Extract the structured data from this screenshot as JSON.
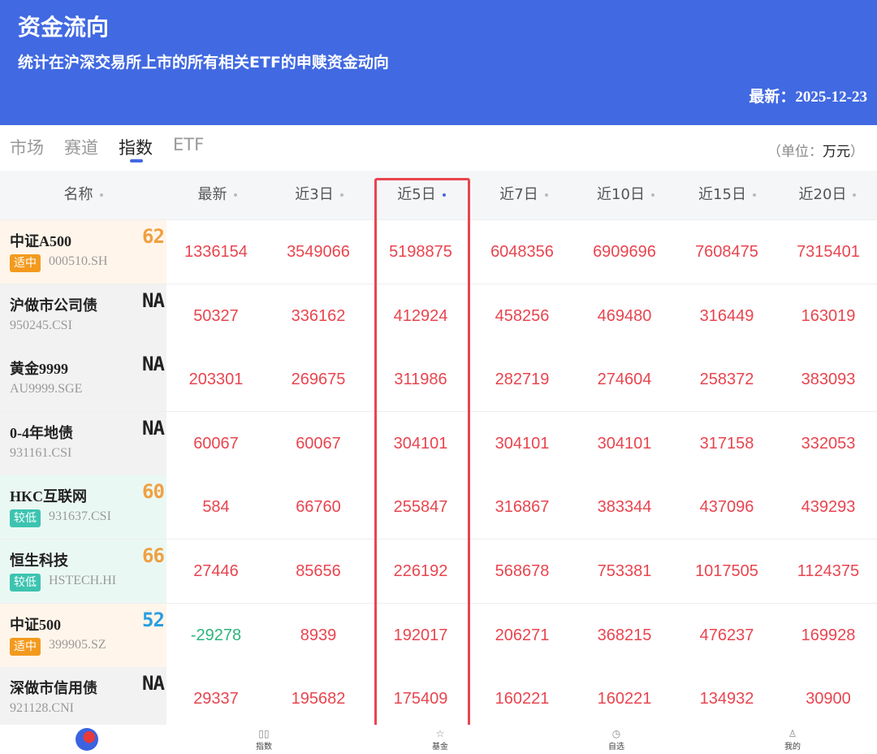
{
  "header": {
    "title": "资金流向",
    "subtitle": "统计在沪深交易所上市的所有相关ETF的申赎资金动向",
    "date_label": "最新：",
    "date": "2025-12-23"
  },
  "tabs": [
    {
      "label": "市场",
      "active": false
    },
    {
      "label": "赛道",
      "active": false
    },
    {
      "label": "指数",
      "active": true
    },
    {
      "label": "ETF",
      "active": false
    }
  ],
  "unit": {
    "prefix": "（单位：",
    "value": "万元",
    "suffix": "）"
  },
  "columns": [
    "名称",
    "最新",
    "近3日",
    "近5日",
    "近7日",
    "近10日",
    "近15日",
    "近20日"
  ],
  "sorted_column": "近5日",
  "colors": {
    "brand": "#4169e1",
    "positive": "#e8454f",
    "negative": "#2db47c",
    "tag_moderate": "#f39a1e",
    "tag_low": "#3cc4b0",
    "highlight_box": "#e8454f"
  },
  "rows": [
    {
      "name": "中证A500",
      "tag": "适中",
      "code": "000510.SH",
      "score": "62",
      "score_color": "#f0a040",
      "bg": "#fff5ea",
      "values": [
        "1336154",
        "3549066",
        "5198875",
        "6048356",
        "6909696",
        "7608475",
        "7315401"
      ]
    },
    {
      "name": "沪做市公司债",
      "tag": "",
      "code": "950245.CSI",
      "score": "NA",
      "score_color": "#222222",
      "bg": "#f2f2f2",
      "values": [
        "50327",
        "336162",
        "412924",
        "458256",
        "469480",
        "316449",
        "163019"
      ]
    },
    {
      "name": "黄金9999",
      "tag": "",
      "code": "AU9999.SGE",
      "score": "NA",
      "score_color": "#222222",
      "bg": "#f2f2f2",
      "values": [
        "203301",
        "269675",
        "311986",
        "282719",
        "274604",
        "258372",
        "383093"
      ]
    },
    {
      "name": "0-4年地债",
      "tag": "",
      "code": "931161.CSI",
      "score": "NA",
      "score_color": "#222222",
      "bg": "#f2f2f2",
      "values": [
        "60067",
        "60067",
        "304101",
        "304101",
        "304101",
        "317158",
        "332053"
      ]
    },
    {
      "name": "HKC互联网",
      "tag": "较低",
      "code": "931637.CSI",
      "score": "60",
      "score_color": "#f0a040",
      "bg": "#eaf8f4",
      "values": [
        "584",
        "66760",
        "255847",
        "316867",
        "383344",
        "437096",
        "439293"
      ]
    },
    {
      "name": "恒生科技",
      "tag": "较低",
      "code": "HSTECH.HI",
      "score": "66",
      "score_color": "#f0a040",
      "bg": "#eaf8f4",
      "values": [
        "27446",
        "85656",
        "226192",
        "568678",
        "753381",
        "1017505",
        "1124375"
      ]
    },
    {
      "name": "中证500",
      "tag": "适中",
      "code": "399905.SZ",
      "score": "52",
      "score_color": "#2a9ee0",
      "bg": "#fff5ea",
      "values": [
        "-29278",
        "8939",
        "192017",
        "206271",
        "368215",
        "476237",
        "169928"
      ]
    },
    {
      "name": "深做市信用债",
      "tag": "",
      "code": "921128.CNI",
      "score": "NA",
      "score_color": "#222222",
      "bg": "#f2f2f2",
      "values": [
        "29337",
        "195682",
        "175409",
        "160221",
        "160221",
        "134932",
        "30900"
      ]
    }
  ],
  "bottom_nav": [
    {
      "label": "",
      "icon": "app-logo-icon"
    },
    {
      "label": "指数",
      "icon": "chart-bars-icon"
    },
    {
      "label": "基金",
      "icon": "star-icon"
    },
    {
      "label": "自选",
      "icon": "clock-icon"
    },
    {
      "label": "我的",
      "icon": "user-icon"
    }
  ]
}
